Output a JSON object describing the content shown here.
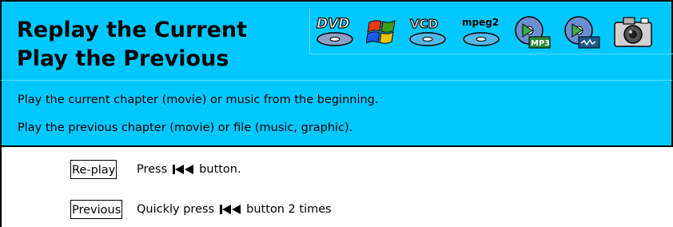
{
  "title": {
    "line1": "Replay the Current",
    "line2": "Play the Previous"
  },
  "media_icons": {
    "dvd": {
      "name": "dvd-icon",
      "label": "DVD"
    },
    "windows": {
      "name": "windows-logo-icon"
    },
    "vcd": {
      "name": "vcd-icon",
      "label": "VCD"
    },
    "mpeg2": {
      "name": "mpeg2-icon",
      "label": "mpeg2"
    },
    "mp3": {
      "name": "mp3-disc-icon",
      "label": "MP3"
    },
    "wma": {
      "name": "wma-disc-icon"
    },
    "camera": {
      "name": "camera-icon"
    }
  },
  "description": {
    "line1": "Play the current chapter (movie) or music from the beginning.",
    "line2": "Play the previous chapter (movie) or file (music, graphic)."
  },
  "steps": [
    {
      "label": "Re-play",
      "before": "Press",
      "after": "button."
    },
    {
      "label": "Previous",
      "before": "Quickly press",
      "after": "button 2 times"
    }
  ],
  "colors": {
    "header_bg": "#00c8ff",
    "text": "#000000"
  }
}
